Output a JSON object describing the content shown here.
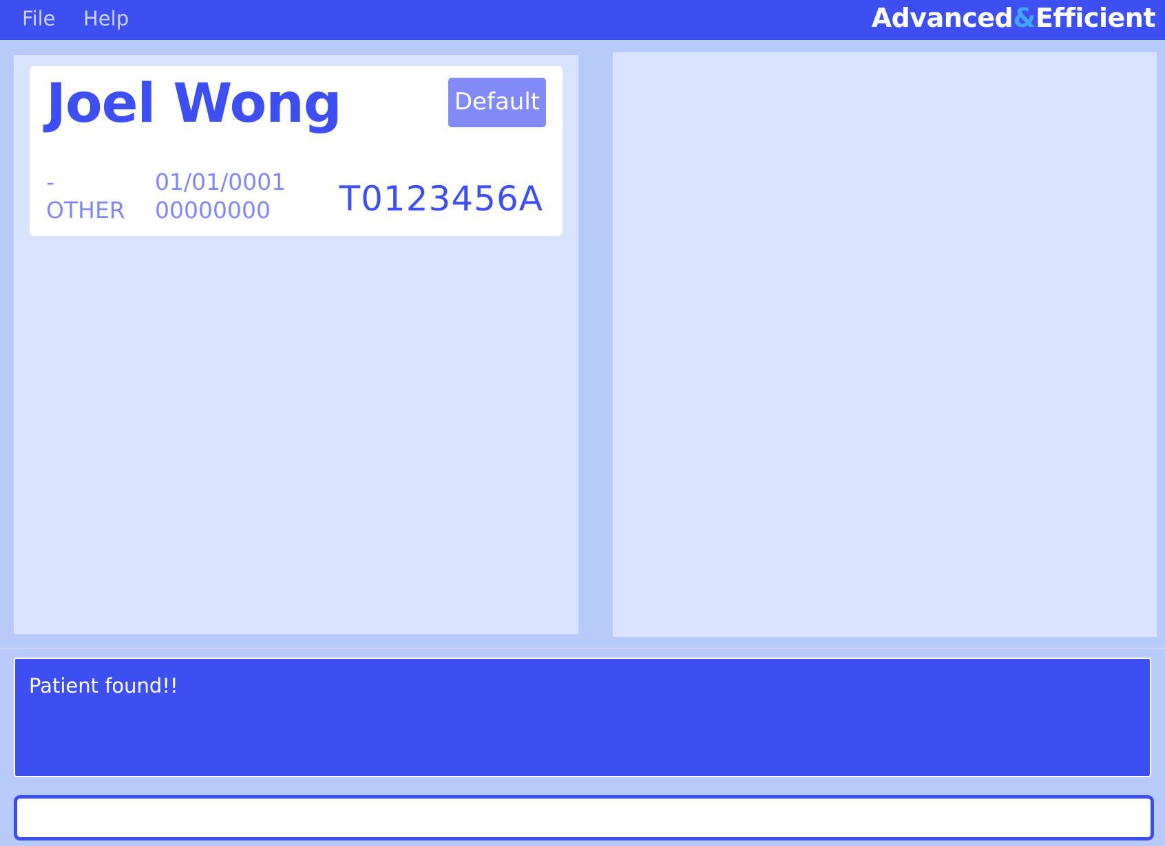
{
  "menu": {
    "file": "File",
    "help": "Help"
  },
  "brand": {
    "part1": "Advanced",
    "amp": "&",
    "part2": "Efficient"
  },
  "patient": {
    "name": "Joel Wong",
    "tag": "Default",
    "blood_type": "-",
    "gender": "OTHER",
    "dob": "01/01/0001",
    "phone": "00000000",
    "nric": "T0123456A"
  },
  "result": {
    "message": "Patient found!!"
  },
  "command": {
    "value": ""
  },
  "colors": {
    "primary": "#3d4ff0",
    "background": "#b8caf9",
    "panel": "#d8e3fe",
    "tag": "#8289f9",
    "muted_text": "#8088f5",
    "brand_amp": "#42a5f5"
  }
}
